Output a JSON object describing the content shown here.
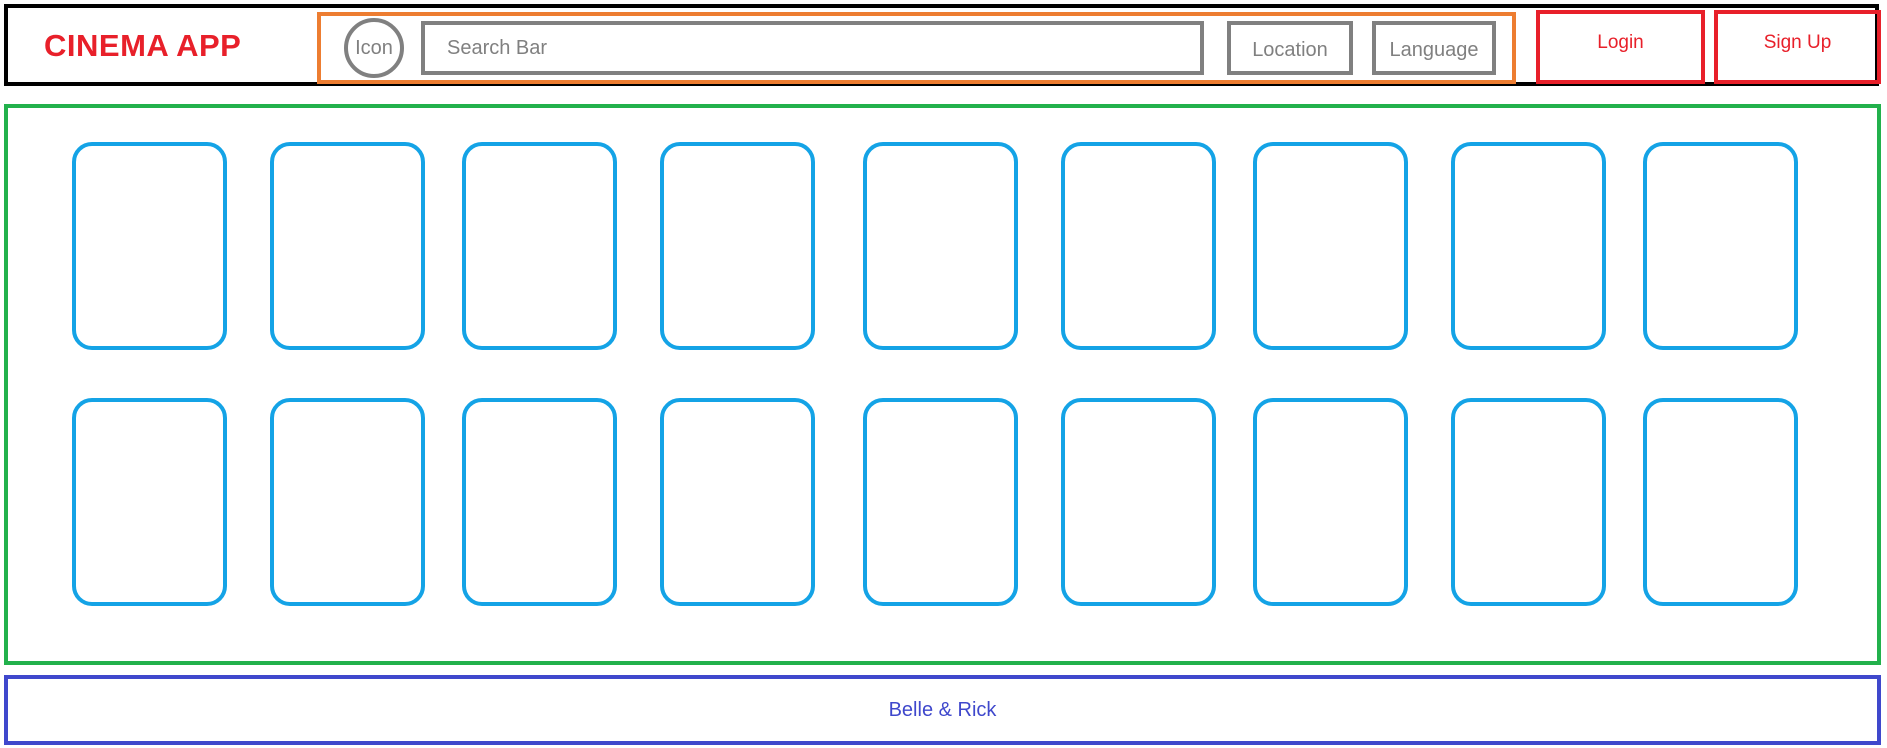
{
  "header": {
    "app_title": "CINEMA APP",
    "icon_label": "Icon",
    "search_text": "Search Bar",
    "location_label": "Location",
    "language_label": "Language",
    "login_label": "Login",
    "signup_label": "Sign Up"
  },
  "grid": {
    "rows": 2,
    "columns": 9
  },
  "footer": {
    "credit": "Belle & Rick"
  },
  "colors": {
    "header_border": "#000000",
    "title": "#e8202a",
    "search_group_border": "#ed7d31",
    "search_controls": "#808080",
    "auth_buttons": "#e8202a",
    "grid_border": "#22b14c",
    "card_border": "#14a3e6",
    "footer": "#3f48cc"
  }
}
